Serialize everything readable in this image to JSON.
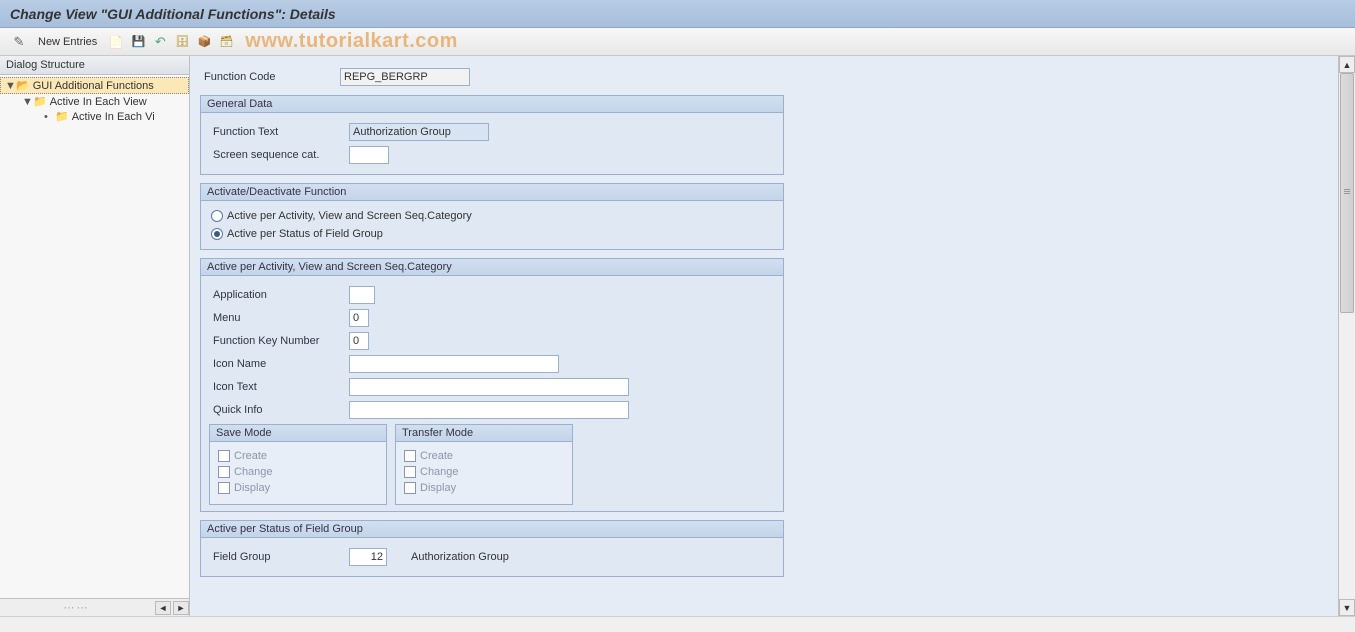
{
  "title": "Change View \"GUI Additional Functions\": Details",
  "watermark": "www.tutorialkart.com",
  "toolbar": {
    "new_entries": "New Entries"
  },
  "sidebar": {
    "header": "Dialog Structure",
    "nodes": [
      {
        "label": "GUI Additional Functions",
        "level": 0,
        "expanded": true,
        "selected": true,
        "open": true
      },
      {
        "label": "Active In Each View",
        "level": 1,
        "expanded": true,
        "selected": false,
        "open": true
      },
      {
        "label": "Active In Each Vi",
        "level": 2,
        "expanded": false,
        "selected": false,
        "open": false
      }
    ]
  },
  "form": {
    "function_code_label": "Function Code",
    "function_code_value": "REPG_BERGRP"
  },
  "general_data": {
    "title": "General Data",
    "function_text_label": "Function Text",
    "function_text_value": "Authorization Group",
    "screen_seq_label": "Screen sequence cat.",
    "screen_seq_value": ""
  },
  "activate": {
    "title": "Activate/Deactivate Function",
    "opt1": "Active per Activity, View and Screen Seq.Category",
    "opt2": "Active per Status of Field Group"
  },
  "per_activity": {
    "title": "Active per Activity, View and Screen Seq.Category",
    "application_label": "Application",
    "application_value": "",
    "menu_label": "Menu",
    "menu_value": "0",
    "fkey_label": "Function Key Number",
    "fkey_value": "0",
    "icon_name_label": "Icon Name",
    "icon_name_value": "",
    "icon_text_label": "Icon Text",
    "icon_text_value": "",
    "quick_info_label": "Quick Info",
    "quick_info_value": "",
    "save_mode_title": "Save Mode",
    "transfer_mode_title": "Transfer Mode",
    "create": "Create",
    "change": "Change",
    "display": "Display"
  },
  "per_status": {
    "title": "Active per Status of Field Group",
    "field_group_label": "Field Group",
    "field_group_value": "12",
    "field_group_text": "Authorization Group"
  }
}
